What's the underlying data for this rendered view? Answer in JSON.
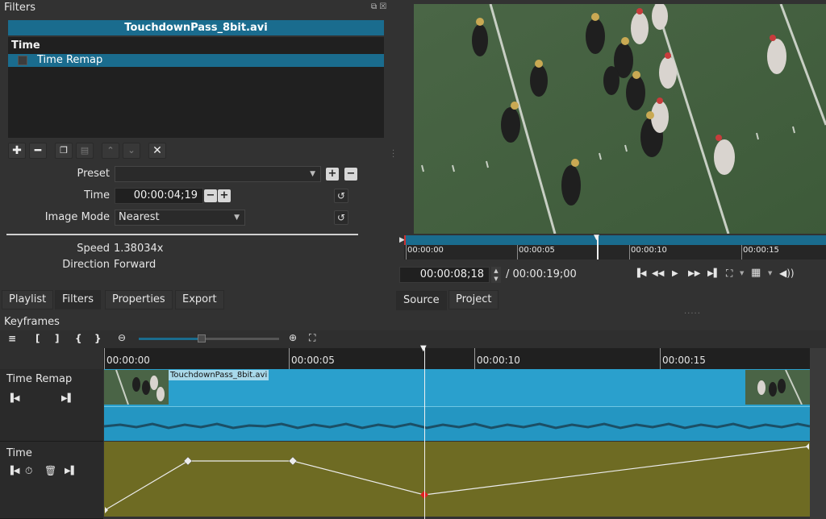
{
  "filters_panel": {
    "title": "Filters",
    "clip_name": "TouchdownPass_8bit.avi",
    "list_header": "Time",
    "list_item": "Time Remap",
    "toolbar_icons": [
      "add-icon",
      "remove-icon",
      "copy-icon",
      "paste-icon",
      "move-up-icon",
      "move-down-icon",
      "deselect-icon"
    ],
    "preset_label": "Preset",
    "preset_value": "",
    "time_label": "Time",
    "time_value": "00:00:04;19",
    "image_mode_label": "Image Mode",
    "image_mode_value": "Nearest",
    "speed_label": "Speed",
    "speed_value": "1.38034x",
    "direction_label": "Direction",
    "direction_value": "Forward"
  },
  "left_tabs": [
    "Playlist",
    "Filters",
    "Properties",
    "Export"
  ],
  "player": {
    "ruler_labels": [
      "00:00:00",
      "00:00:05",
      "00:00:10",
      "00:00:15"
    ],
    "current_time": "00:00:08;18",
    "total_duration": "/ 00:00:19;00",
    "tabs": [
      "Source",
      "Project"
    ],
    "transport_icons": [
      "skip-to-start-icon",
      "rewind-icon",
      "play-icon",
      "fast-forward-icon",
      "skip-to-end-icon",
      "zoom-icon",
      "grid-icon",
      "volume-icon"
    ]
  },
  "keyframes": {
    "title": "Keyframes",
    "toolbar_labels": [
      "≡",
      "[",
      "]",
      "{",
      "}"
    ],
    "zoom_level": 0.45,
    "ruler_labels": [
      "00:00:00",
      "00:00:05",
      "00:00:10",
      "00:00:15"
    ],
    "tracks": [
      {
        "name": "Time Remap",
        "clip_label": "TouchdownPass_8bit.avi"
      },
      {
        "name": "Time"
      }
    ],
    "keyframe_times": [
      "00:00:00",
      "00:00:02;10",
      "00:00:05;05",
      "00:00:08;18",
      "00:00:19;00"
    ]
  },
  "colors": {
    "selection": "#1a6c8e",
    "clip": "#2aa0cd",
    "keyframe_area": "#6e6b23",
    "active_keyframe": "#e02020"
  }
}
